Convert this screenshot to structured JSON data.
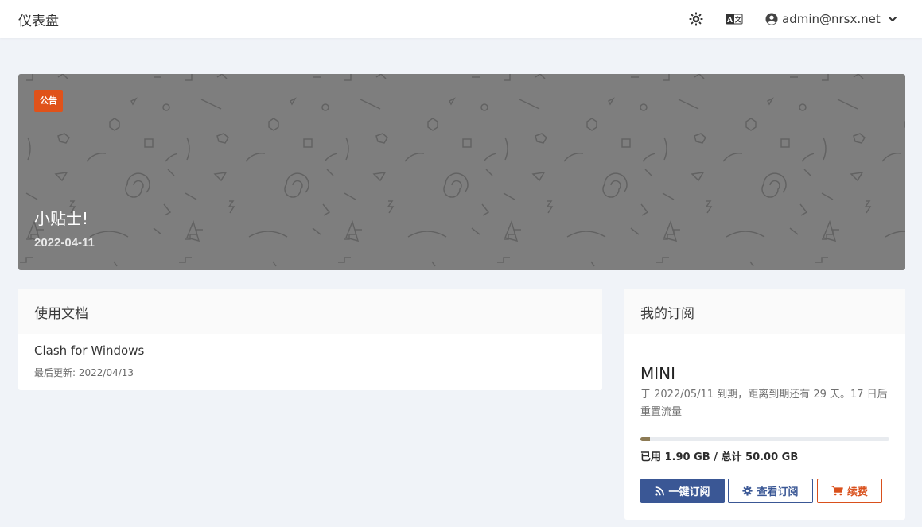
{
  "header": {
    "title": "仪表盘",
    "theme_icon": "sun-gear-icon",
    "language_icon": "translate-icon",
    "user_email": "admin@nrsx.net",
    "user_icon": "user-circle-icon",
    "dropdown_icon": "chevron-down-icon"
  },
  "announcement": {
    "badge": "公告",
    "title": "小贴士!",
    "date": "2022-04-11",
    "background_color": "#7e7e7e",
    "badge_color": "#e0521a"
  },
  "docs": {
    "header": "使用文档",
    "items": [
      {
        "title": "Clash for Windows",
        "updated": "最后更新: 2022/04/13"
      }
    ]
  },
  "subscription": {
    "header": "我的订阅",
    "plan": "MINI",
    "description": "于 2022/05/11 到期，距离到期还有 29 天。17 日后重置流量",
    "used_gb": 1.9,
    "total_gb": 50.0,
    "usage_text": "已用 1.90 GB / 总计 50.00 GB",
    "progress_color": "#8d7b55",
    "buttons": {
      "subscribe": "一键订阅",
      "view": "查看订阅",
      "renew": "续费"
    },
    "primary_color": "#3a5795",
    "danger_color": "#d9501c"
  }
}
